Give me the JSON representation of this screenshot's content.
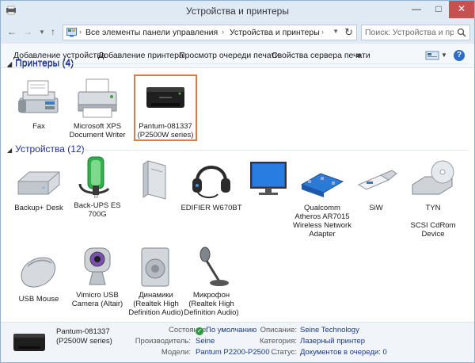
{
  "window": {
    "title": "Устройства и принтеры",
    "min_glyph": "—",
    "max_glyph": "□",
    "close_glyph": "✕"
  },
  "address": {
    "crumbs": [
      "Все элементы панели управления",
      "Устройства и принтеры"
    ],
    "search_placeholder": "Поиск: Устройства и принте..."
  },
  "toolbar": {
    "add_device": "Добавление устройства",
    "add_printer": "Добавление принтера",
    "print_queue": "Просмотр очереди печати",
    "server_props": "Свойства сервера печати",
    "more": "»"
  },
  "sections": {
    "printers_header": "Принтеры (4)",
    "devices_header": "Устройства (12)"
  },
  "printers": [
    {
      "label": "Fax",
      "icon": "fax-icon"
    },
    {
      "label": "Microsoft XPS\nDocument Writer",
      "icon": "xps-printer-icon"
    },
    {
      "label": "Pantum-081337\n(P2500W series)",
      "icon": "laser-printer-icon",
      "selected": true
    }
  ],
  "devices": [
    {
      "label": "Backup+ Desk",
      "icon": "external-drive-icon"
    },
    {
      "label": "Back-UPS ES\n700G",
      "icon": "ups-battery-icon"
    },
    {
      "label": "",
      "icon": "storage-tower-icon"
    },
    {
      "label": "EDIFIER W670BT",
      "icon": "headset-icon"
    },
    {
      "label": "",
      "icon": "monitor-icon"
    },
    {
      "label": "Qualcomm\nAtheros AR7015\nWireless Network\nAdapter",
      "icon": "network-adapter-icon"
    },
    {
      "label": "SiW",
      "icon": "usb-flash-icon"
    },
    {
      "label": "TYN\n\nSCSI CdRom\nDevice",
      "icon": "cdrom-drive-icon"
    },
    {
      "label": "USB Mouse",
      "icon": "mouse-icon"
    },
    {
      "label": "Vimicro USB\nCamera (Altair)",
      "icon": "webcam-icon"
    },
    {
      "label": "Динамики\n(Realtek High\nDefinition Audio)",
      "icon": "speaker-icon"
    },
    {
      "label": "Микрофон\n(Realtek High\nDefinition Audio)",
      "icon": "microphone-icon"
    }
  ],
  "details": {
    "name": "Pantum-081337\n(P2500W series)",
    "state_key": "Состояние:",
    "state_val": "По умолчанию",
    "maker_key": "Производитель:",
    "maker_val": "Seine",
    "model_key": "Модели:",
    "model_val": "Pantum P2200-P2500 ...",
    "desc_key": "Описание:",
    "desc_val": "Seine Technology",
    "cat_key": "Категория:",
    "cat_val": "Лазерный принтер",
    "status_key": "Статус:",
    "status_val": "Документов в очереди: 0"
  }
}
